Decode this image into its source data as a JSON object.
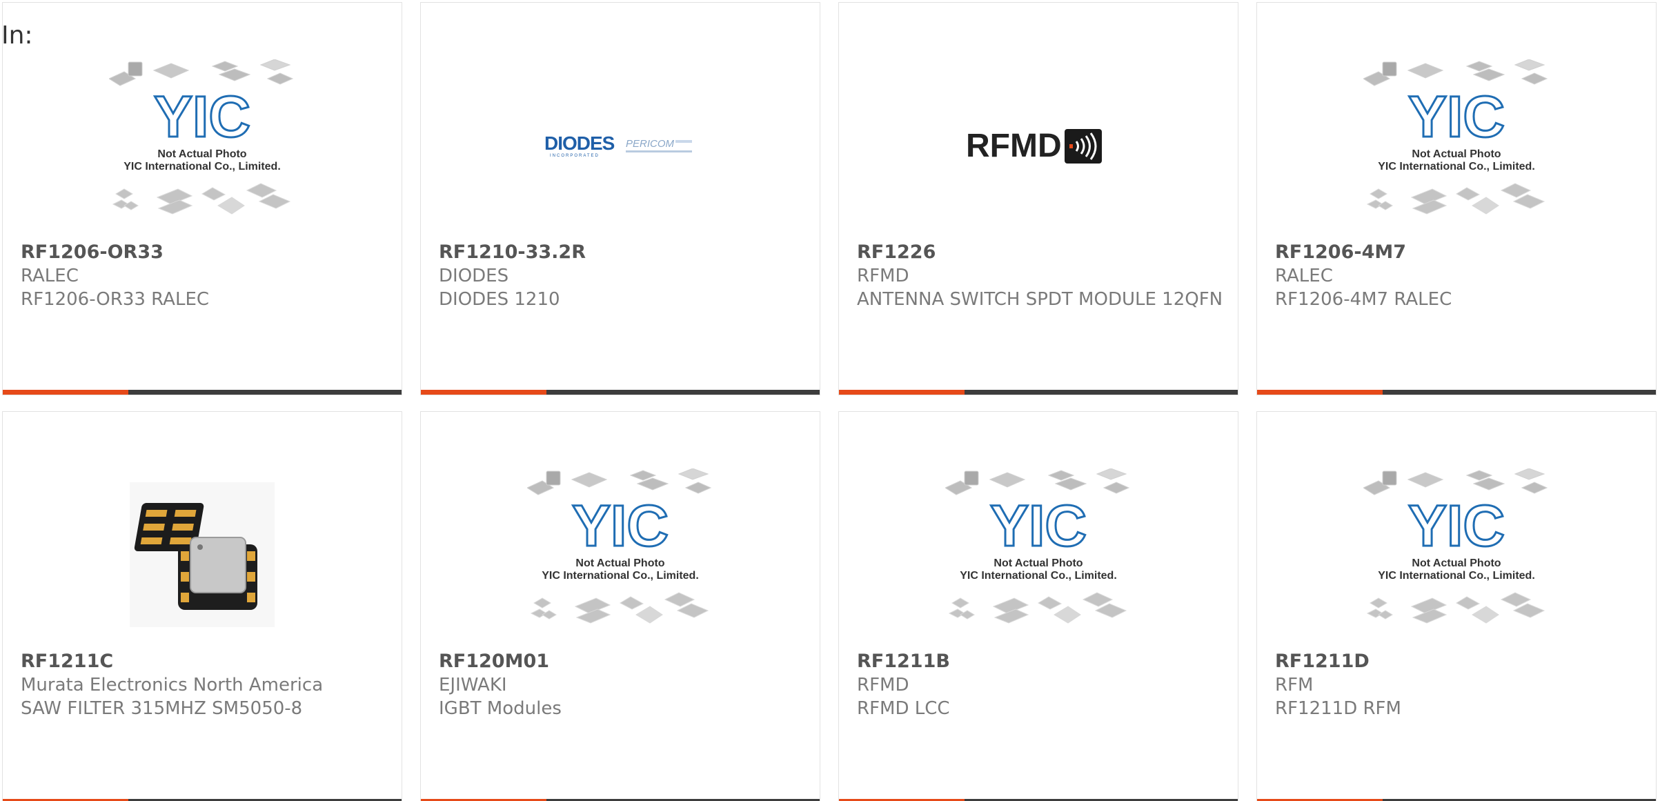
{
  "header": {
    "label": "In:"
  },
  "colors": {
    "accent": "#e64a19",
    "bar": "#3d3d3d",
    "border": "#e2e2e2",
    "part_number": "#555555",
    "secondary_text": "#7a7a7a",
    "yic_blue": "#1f6db3",
    "diodes_blue": "#1f5fa8",
    "rfmd_dark": "#222222"
  },
  "placeholder": {
    "logo_text": "YIC",
    "line1": "Not Actual Photo",
    "line2": "YIC International Co., Limited."
  },
  "brand_logos": {
    "diodes": "DIODES",
    "diodes_sub": "INCORPORATED",
    "pericom": "PERICOM",
    "rfmd": "RFMD"
  },
  "products": [
    {
      "part_number": "RF1206-OR33",
      "manufacturer": "RALEC",
      "description": "RF1206-OR33 RALEC",
      "image": "placeholder"
    },
    {
      "part_number": "RF1210-33.2R",
      "manufacturer": "DIODES",
      "description": "DIODES 1210",
      "image": "diodes-logo"
    },
    {
      "part_number": "RF1226",
      "manufacturer": "RFMD",
      "description": "ANTENNA SWITCH SPDT MODULE 12QFN",
      "image": "rfmd-logo"
    },
    {
      "part_number": "RF1206-4M7",
      "manufacturer": "RALEC",
      "description": "RF1206-4M7 RALEC",
      "image": "placeholder"
    },
    {
      "part_number": "RF1211C",
      "manufacturer": "Murata Electronics North America",
      "description": "SAW FILTER 315MHZ SM5050-8",
      "image": "saw-filter-photo"
    },
    {
      "part_number": "RF120M01",
      "manufacturer": "EJIWAKI",
      "description": "IGBT Modules",
      "image": "placeholder"
    },
    {
      "part_number": "RF1211B",
      "manufacturer": "RFMD",
      "description": "RFMD LCC",
      "image": "placeholder"
    },
    {
      "part_number": "RF1211D",
      "manufacturer": "RFM",
      "description": "RF1211D RFM",
      "image": "placeholder"
    }
  ]
}
